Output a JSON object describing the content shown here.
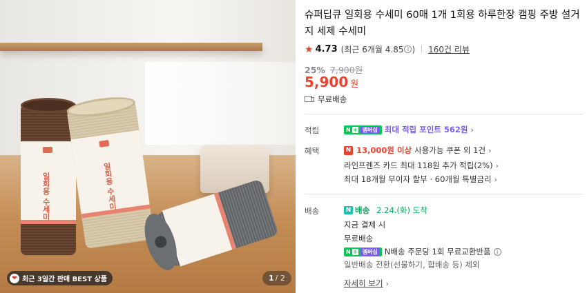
{
  "gallery": {
    "best_badge": "최근 3일간 판매 BEST 상품",
    "page_current": "1",
    "page_total": "/ 2",
    "roll_label": "일회용 수세미"
  },
  "product": {
    "title": "슈퍼딥큐 일회용 수세미 60매 1개 1회용 하루한장 캠핑 주방 설거지 세제 수세미",
    "rating": "4.73",
    "recent_rating": "(최근 6개월 4.85",
    "recent_rating_close": ")",
    "review_count": "160건 리뷰",
    "discount_rate": "25%",
    "original_price": "7,900원",
    "price": "5,900",
    "currency": "원",
    "shipping": "무료배송"
  },
  "points": {
    "label": "적립",
    "badge_n": "N",
    "badge_plus": "+",
    "badge_member": "멤버십",
    "text": "최대 적립 포인트",
    "amount": "562원"
  },
  "benefits": {
    "label": "혜택",
    "coupon_badge": "N",
    "coupon_strong": "13,000원 이상",
    "coupon_text": "사용가능 쿠폰 외 1건",
    "card_text": "라인프렌즈 카드 최대 118원 추가 적립(2%)",
    "installment_text": "최대 18개월 무이자 할부 · 60개월 특별금리"
  },
  "delivery": {
    "label": "배송",
    "n_icon": "N",
    "type": "배송",
    "arrival": "2.24.(화) 도착",
    "payment": "지금 결제 시",
    "fee": "무료배송",
    "return_text": "N배송 주문당 1회 무료교환반품",
    "return_note": "일반배송 전환(선물하기, 합배송 등) 제외",
    "detail_link": "자세히 보기"
  },
  "colors": {
    "price_red": "#e8432f",
    "npay_green": "#06c755",
    "membership_purple": "#7b5cf0",
    "delivery_green": "#0aa85b"
  }
}
